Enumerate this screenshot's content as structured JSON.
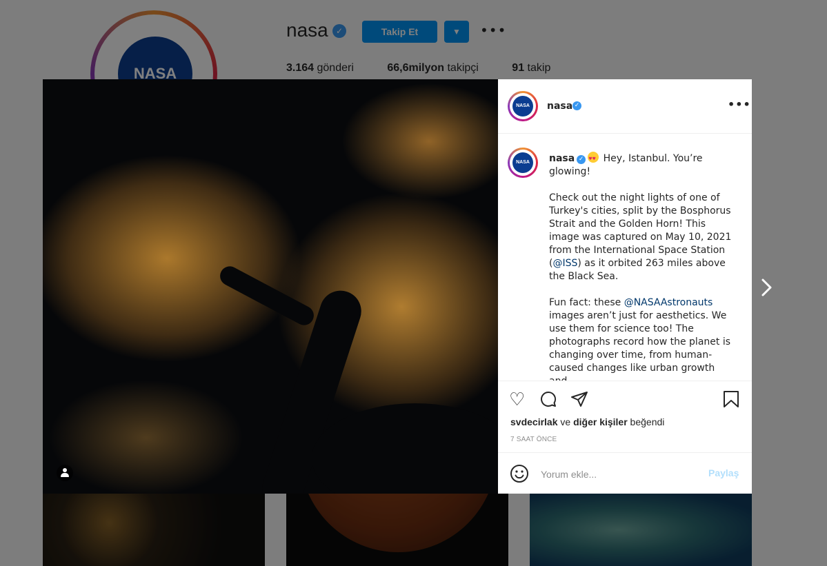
{
  "profile": {
    "username": "nasa",
    "follow_label": "Takip Et",
    "stats": [
      {
        "count": "3.164",
        "label": "gönderi"
      },
      {
        "count": "66,6milyon",
        "label": "takipçi"
      },
      {
        "count": "91",
        "label": "takip"
      }
    ],
    "logo_text": "NASA"
  },
  "post": {
    "username": "nasa",
    "logo_text": "NASA",
    "caption": {
      "first_line": " Hey, Istanbul. You’re glowing!",
      "para1": "Check out the night lights of one of Turkey's cities, split by the Bosphorus Strait and the Golden Horn! This image was captured on May 10, 2021 from the International Space Station (",
      "iss_mention": "@ISS",
      "para1_end": ") as it orbited 263 miles above the Black Sea.",
      "para2_start": "Fun fact: these ",
      "astronauts_mention": "@NASAAstronauts",
      "para2_end": " images aren’t just for aesthetics. We use them for science too! The photographs record how the planet is changing over time, from human-caused changes like urban growth and"
    },
    "likes": {
      "user": "svdecirlak",
      "connector": " ve ",
      "others": "diğer kişiler",
      "suffix": " beğendi"
    },
    "time": "7 SAAT ÖNCE",
    "comment_placeholder": "Yorum ekle...",
    "post_label": "Paylaş"
  },
  "colors": {
    "accent": "#0095f6",
    "verified": "#3897f0",
    "link": "#00376b"
  }
}
